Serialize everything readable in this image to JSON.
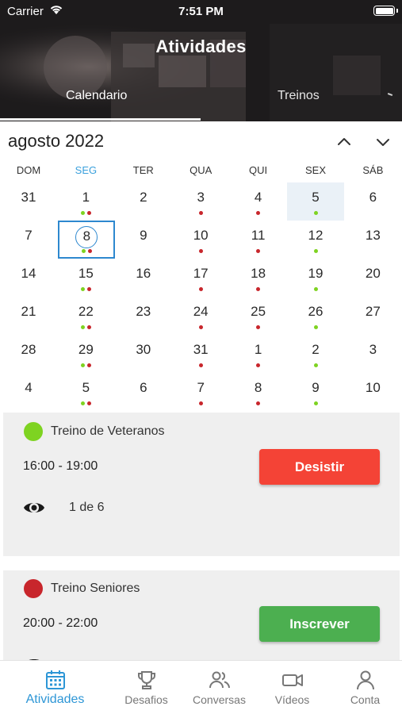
{
  "status_bar": {
    "carrier": "Carrier",
    "time": "7:51 PM"
  },
  "header": {
    "title": "Atividades"
  },
  "tabs": [
    {
      "label": "Calendario",
      "active": true
    },
    {
      "label": "Treinos",
      "active": false
    }
  ],
  "calendar": {
    "month_label": "agosto 2022",
    "weekdays": [
      "DOM",
      "SEG",
      "TER",
      "QUA",
      "QUI",
      "SEX",
      "SÁB"
    ],
    "active_weekday_index": 1,
    "weeks": [
      [
        {
          "d": "31",
          "dots": []
        },
        {
          "d": "1",
          "dots": [
            "g",
            "r"
          ]
        },
        {
          "d": "2",
          "dots": []
        },
        {
          "d": "3",
          "dots": [
            "r"
          ]
        },
        {
          "d": "4",
          "dots": [
            "r"
          ]
        },
        {
          "d": "5",
          "dots": [
            "g"
          ],
          "today": true
        },
        {
          "d": "6",
          "dots": []
        }
      ],
      [
        {
          "d": "7",
          "dots": []
        },
        {
          "d": "8",
          "dots": [
            "g",
            "r"
          ],
          "selected": true
        },
        {
          "d": "9",
          "dots": []
        },
        {
          "d": "10",
          "dots": [
            "r"
          ]
        },
        {
          "d": "11",
          "dots": [
            "r"
          ]
        },
        {
          "d": "12",
          "dots": [
            "g"
          ]
        },
        {
          "d": "13",
          "dots": []
        }
      ],
      [
        {
          "d": "14",
          "dots": []
        },
        {
          "d": "15",
          "dots": [
            "g",
            "r"
          ]
        },
        {
          "d": "16",
          "dots": []
        },
        {
          "d": "17",
          "dots": [
            "r"
          ]
        },
        {
          "d": "18",
          "dots": [
            "r"
          ]
        },
        {
          "d": "19",
          "dots": [
            "g"
          ]
        },
        {
          "d": "20",
          "dots": []
        }
      ],
      [
        {
          "d": "21",
          "dots": []
        },
        {
          "d": "22",
          "dots": [
            "g",
            "r"
          ]
        },
        {
          "d": "23",
          "dots": []
        },
        {
          "d": "24",
          "dots": [
            "r"
          ]
        },
        {
          "d": "25",
          "dots": [
            "r"
          ]
        },
        {
          "d": "26",
          "dots": [
            "g"
          ]
        },
        {
          "d": "27",
          "dots": []
        }
      ],
      [
        {
          "d": "28",
          "dots": []
        },
        {
          "d": "29",
          "dots": [
            "g",
            "r"
          ]
        },
        {
          "d": "30",
          "dots": []
        },
        {
          "d": "31",
          "dots": [
            "r"
          ]
        },
        {
          "d": "1",
          "dots": [
            "r"
          ]
        },
        {
          "d": "2",
          "dots": [
            "g"
          ]
        },
        {
          "d": "3",
          "dots": []
        }
      ],
      [
        {
          "d": "4",
          "dots": []
        },
        {
          "d": "5",
          "dots": [
            "g",
            "r"
          ]
        },
        {
          "d": "6",
          "dots": []
        },
        {
          "d": "7",
          "dots": [
            "r"
          ]
        },
        {
          "d": "8",
          "dots": [
            "r"
          ]
        },
        {
          "d": "9",
          "dots": [
            "g"
          ]
        },
        {
          "d": "10",
          "dots": []
        }
      ]
    ]
  },
  "events": [
    {
      "name": "Treino de Veteranos",
      "color": "#7ed321",
      "time": "16:00 - 19:00",
      "action_label": "Desistir",
      "action_color": "#f44336",
      "vacancy": "1 de 6"
    },
    {
      "name": "Treino Seniores",
      "color": "#c8262c",
      "time": "20:00 - 22:00",
      "action_label": "Inscrever",
      "action_color": "#4caf50"
    }
  ],
  "bottom_nav": [
    {
      "label": "Atividades",
      "icon": "calendar-icon",
      "active": true
    },
    {
      "label": "Desafios",
      "icon": "trophy-icon",
      "active": false
    },
    {
      "label": "Conversas",
      "icon": "people-icon",
      "active": false
    },
    {
      "label": "Vídeos",
      "icon": "video-camera-icon",
      "active": false
    },
    {
      "label": "Conta",
      "icon": "person-icon",
      "active": false
    }
  ],
  "colors": {
    "accent": "#2d96d6",
    "dot_green": "#7ed321",
    "dot_red": "#c8262c"
  }
}
